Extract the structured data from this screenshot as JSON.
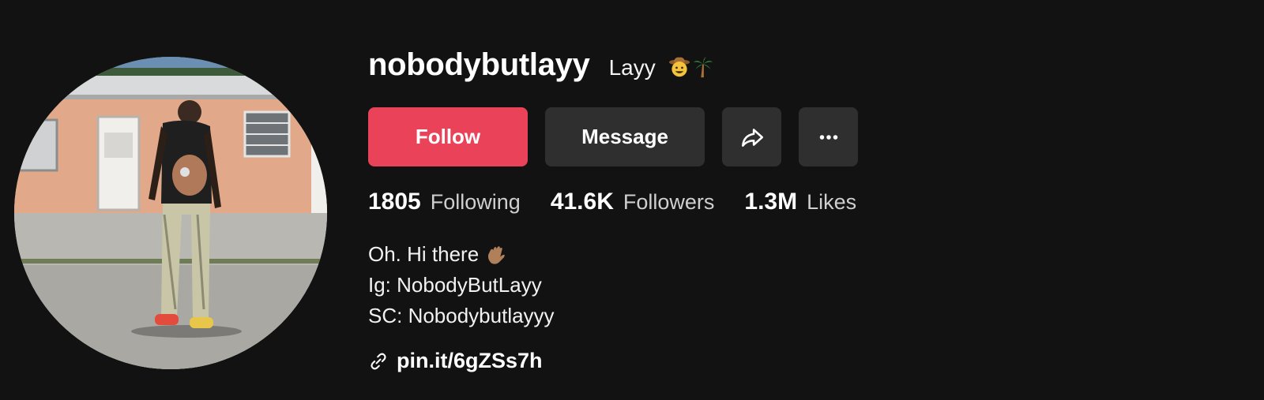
{
  "profile": {
    "username": "nobodybutlayy",
    "nickname": "Layy",
    "nickname_emojis": [
      "cowboy-face-emoji",
      "palm-tree-emoji"
    ]
  },
  "actions": {
    "follow_label": "Follow",
    "message_label": "Message",
    "share_icon": "share-arrow-icon",
    "more_icon": "more-dots-icon"
  },
  "stats": [
    {
      "value": "1805",
      "label": "Following"
    },
    {
      "value": "41.6K",
      "label": "Followers"
    },
    {
      "value": "1.3M",
      "label": "Likes"
    }
  ],
  "bio": {
    "line1": "Oh. Hi there",
    "line1_emoji": "waving-hand-emoji",
    "line2": "Ig: NobodyButLayy",
    "line3": "SC: Nobodybutlayyy"
  },
  "link": {
    "icon": "link-icon",
    "text": "pin.it/6gZSs7h"
  },
  "colors": {
    "background": "#121212",
    "follow_button": "#ea4359",
    "secondary_button": "#2f2f2f",
    "secondary_text": "#cfcfcf"
  }
}
